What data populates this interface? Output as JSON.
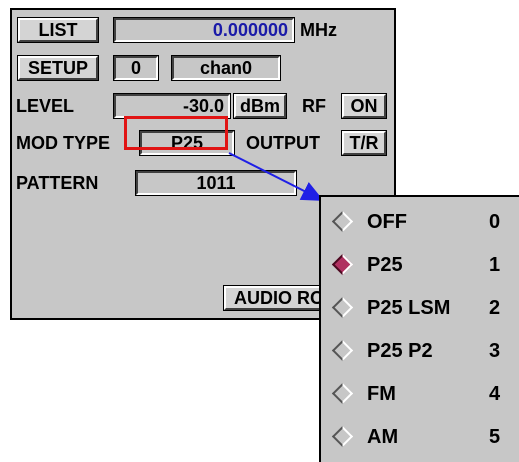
{
  "list_button": "LIST",
  "frequency": {
    "value": "0.000000",
    "unit": "MHz"
  },
  "setup_button": "SETUP",
  "setup_index": "0",
  "channel_name": "chan0",
  "level": {
    "label": "LEVEL",
    "value": "-30.0",
    "unit": "dBm"
  },
  "rf": {
    "label": "RF",
    "state": "ON"
  },
  "mod_type": {
    "label": "MOD TYPE",
    "value": "P25"
  },
  "output": {
    "label": "OUTPUT",
    "value": "T/R"
  },
  "pattern": {
    "label": "PATTERN",
    "value": "1011"
  },
  "audio_button": "AUDIO RO",
  "mod_menu": {
    "selected_index": 1,
    "items": [
      {
        "label": "OFF",
        "num": "0"
      },
      {
        "label": "P25",
        "num": "1"
      },
      {
        "label": "P25 LSM",
        "num": "2"
      },
      {
        "label": "P25 P2",
        "num": "3"
      },
      {
        "label": "FM",
        "num": "4"
      },
      {
        "label": "AM",
        "num": "5"
      }
    ]
  },
  "colors": {
    "highlight": "#e11414",
    "arrow": "#1f1fe6",
    "selected_radio": "#b03060",
    "freq_text": "#1a1aa8"
  }
}
